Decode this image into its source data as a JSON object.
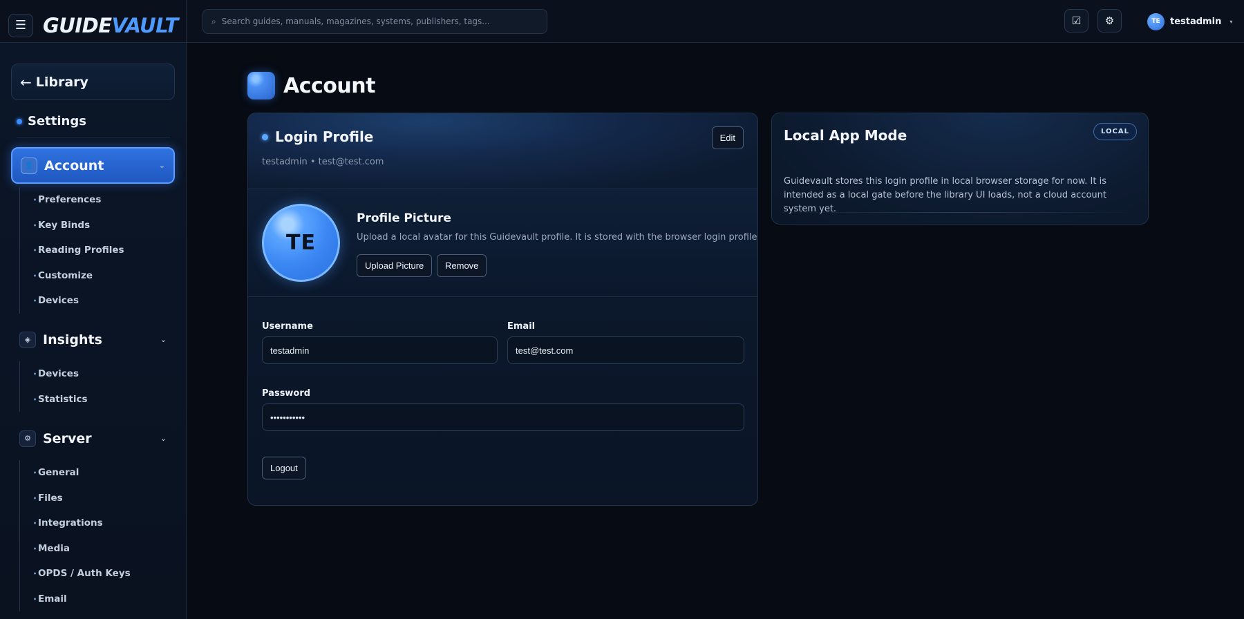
{
  "app": {
    "logo_part1": "GUIDE",
    "logo_part2": "VAULT",
    "menu_icon": "☰"
  },
  "topbar": {
    "search_placeholder": "Search guides, manuals, magazines, systems, publishers, tags...",
    "search_value": "",
    "search_icon": "⌕",
    "tasks_icon": "☑",
    "settings_icon": "⚙",
    "user_initials": "TE",
    "username": "testadmin",
    "caret": "▾"
  },
  "sidebar": {
    "back_arrow": "←",
    "back_label": "Library",
    "section_label": "Settings",
    "groups": [
      {
        "label": "Account",
        "icon": "👤",
        "chevron": "⌄",
        "items": [
          "Preferences",
          "Key Binds",
          "Reading Profiles",
          "Customize",
          "Devices"
        ]
      },
      {
        "label": "Insights",
        "icon": "◈",
        "chevron": "⌄",
        "items": [
          "Devices",
          "Statistics"
        ]
      },
      {
        "label": "Server",
        "icon": "⚙",
        "chevron": "⌄",
        "items": [
          "General",
          "Files",
          "Integrations",
          "Media",
          "OPDS / Auth Keys",
          "Email"
        ]
      }
    ]
  },
  "main": {
    "page_title": "Account",
    "login_profile": {
      "title": "Login Profile",
      "subtitle": "testadmin • test@test.com",
      "edit_label": "Edit",
      "avatar_initials": "TE",
      "picture_title": "Profile Picture",
      "picture_desc": "Upload a local avatar for this Guidevault profile. It is stored with the browser login profile.",
      "upload_label": "Upload Picture",
      "remove_label": "Remove",
      "username_label": "Username",
      "username_value": "testadmin",
      "email_label": "Email",
      "email_value": "test@test.com",
      "password_label": "Password",
      "password_value": "•••••••••••",
      "logout_label": "Logout"
    },
    "local_mode": {
      "title": "Local App Mode",
      "badge": "LOCAL",
      "description": "Guidevault stores this login profile in local browser storage for now. It is intended as a local gate before the library UI loads, not a cloud account system yet."
    }
  },
  "colors": {
    "accent": "#3b8cff",
    "background": "#060b14",
    "card": "#0d1b30"
  }
}
